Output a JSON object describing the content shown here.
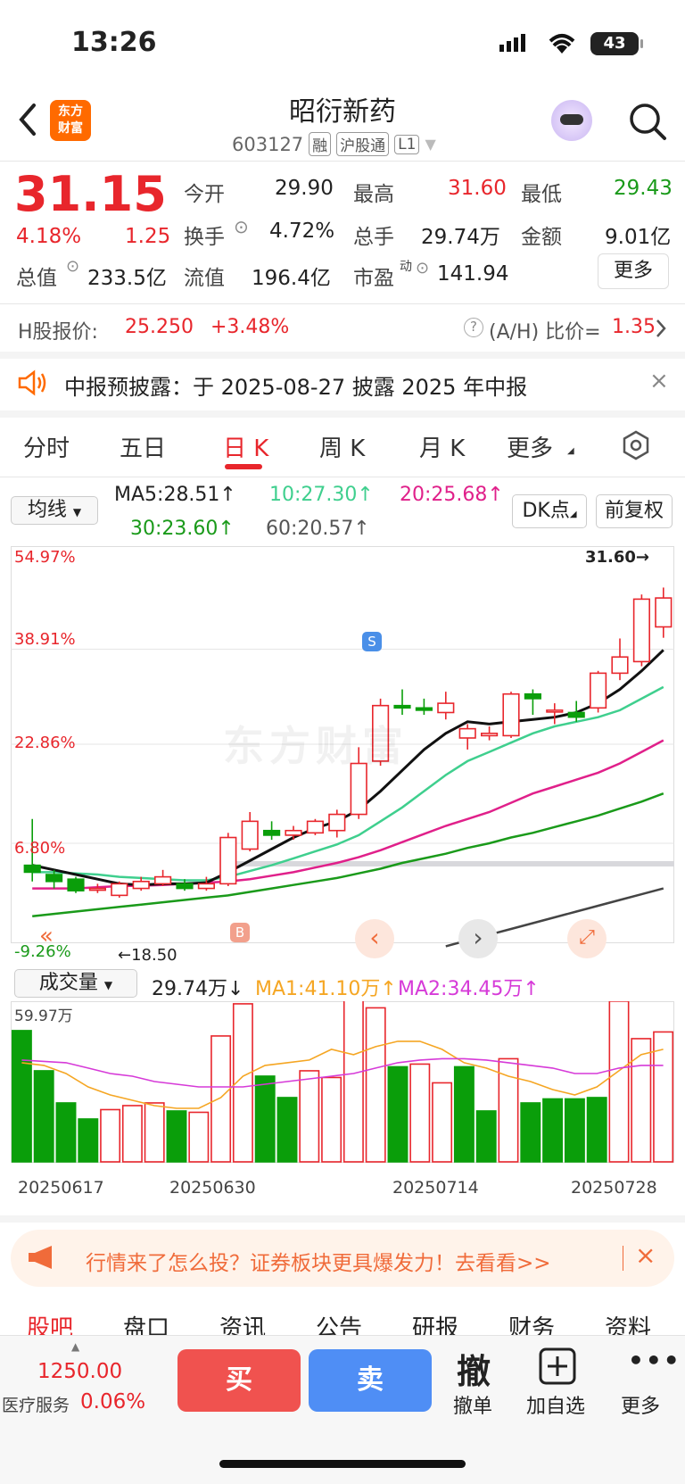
{
  "status": {
    "time": "13:26",
    "battery": "43"
  },
  "header": {
    "name": "昭衍新药",
    "code": "603127",
    "tags": [
      "融",
      "沪股通",
      "L1"
    ]
  },
  "quote": {
    "price": "31.15",
    "change_pct": "4.18%",
    "change": "1.25",
    "open_label": "今开",
    "open": "29.90",
    "high_label": "最高",
    "high": "31.60",
    "low_label": "最低",
    "low": "29.43",
    "turnover_label": "换手",
    "turnover": "4.72%",
    "volume_label": "总手",
    "volume": "29.74万",
    "amount_label": "金额",
    "amount": "9.01亿",
    "mktcap_label": "总值",
    "mktcap": "233.5亿",
    "float_label": "流值",
    "float": "196.4亿",
    "pe_label": "市盈",
    "pe_sup": "动",
    "pe": "141.94",
    "more": "更多"
  },
  "hshare": {
    "label": "H股报价:",
    "price": "25.250",
    "pct": "+3.48%",
    "ah_label": "(A/H) 比价=",
    "ah": "1.35"
  },
  "notice": {
    "text": "中报预披露：于 2025-08-27 披露 2025 年中报"
  },
  "tabs": [
    "分时",
    "五日",
    "日 K",
    "周 K",
    "月 K",
    "更多"
  ],
  "ma_bar": {
    "selector": "均线",
    "ma5": "MA5:28.51↑",
    "ma10": "10:27.30↑",
    "ma20": "20:25.68↑",
    "ma30": "30:23.60↑",
    "ma60": "60:20.57↑",
    "dk": "DK点",
    "fq": "前复权"
  },
  "kchart": {
    "y_labels": [
      "54.97%",
      "38.91%",
      "22.86%",
      "6.80%",
      "-9.26%"
    ],
    "max_label": "31.60→",
    "min_label": "←18.50",
    "watermark": "东方财富",
    "s_marker": "S",
    "b_marker": "B"
  },
  "vol_bar": {
    "selector": "成交量",
    "vol": "29.74万↓",
    "ma1": "MA1:41.10万↑",
    "ma2": "MA2:34.45万↑",
    "top_label": "59.97万"
  },
  "x_dates": [
    "20250617",
    "20250630",
    "20250714",
    "20250728"
  ],
  "chart_data": {
    "type": "candlestick",
    "price_range": [
      16.27,
      33.39
    ],
    "candles": [
      {
        "o": 19.6,
        "c": 19.3,
        "h": 21.6,
        "l": 18.9
      },
      {
        "o": 19.2,
        "c": 18.9,
        "h": 19.4,
        "l": 18.6
      },
      {
        "o": 19.0,
        "c": 18.5,
        "h": 19.1,
        "l": 18.4
      },
      {
        "o": 18.6,
        "c": 18.6,
        "h": 18.8,
        "l": 18.4
      },
      {
        "o": 18.3,
        "c": 18.8,
        "h": 18.9,
        "l": 18.2
      },
      {
        "o": 18.6,
        "c": 18.9,
        "h": 19.1,
        "l": 18.5
      },
      {
        "o": 18.8,
        "c": 19.1,
        "h": 19.4,
        "l": 18.7
      },
      {
        "o": 18.8,
        "c": 18.6,
        "h": 19.0,
        "l": 18.5
      },
      {
        "o": 18.6,
        "c": 18.8,
        "h": 19.1,
        "l": 18.5
      },
      {
        "o": 18.8,
        "c": 20.8,
        "h": 21.0,
        "l": 18.7
      },
      {
        "o": 20.3,
        "c": 21.5,
        "h": 21.9,
        "l": 20.2
      },
      {
        "o": 21.1,
        "c": 20.9,
        "h": 21.5,
        "l": 20.7
      },
      {
        "o": 20.9,
        "c": 21.1,
        "h": 21.3,
        "l": 20.7
      },
      {
        "o": 21.0,
        "c": 21.5,
        "h": 21.6,
        "l": 20.9
      },
      {
        "o": 21.1,
        "c": 21.8,
        "h": 22.0,
        "l": 20.8
      },
      {
        "o": 21.8,
        "c": 24.0,
        "h": 24.7,
        "l": 21.6
      },
      {
        "o": 24.1,
        "c": 26.5,
        "h": 26.8,
        "l": 23.9
      },
      {
        "o": 26.5,
        "c": 26.4,
        "h": 27.2,
        "l": 26.1
      },
      {
        "o": 26.4,
        "c": 26.3,
        "h": 26.8,
        "l": 26.1
      },
      {
        "o": 26.2,
        "c": 26.6,
        "h": 27.1,
        "l": 25.9
      },
      {
        "o": 25.1,
        "c": 25.5,
        "h": 25.7,
        "l": 24.6
      },
      {
        "o": 25.2,
        "c": 25.3,
        "h": 25.6,
        "l": 25.0
      },
      {
        "o": 25.2,
        "c": 27.0,
        "h": 27.1,
        "l": 25.1
      },
      {
        "o": 27.0,
        "c": 26.8,
        "h": 27.2,
        "l": 26.1
      },
      {
        "o": 26.3,
        "c": 26.3,
        "h": 26.6,
        "l": 25.7
      },
      {
        "o": 26.2,
        "c": 26.0,
        "h": 26.7,
        "l": 25.8
      },
      {
        "o": 26.4,
        "c": 27.9,
        "h": 28.0,
        "l": 26.2
      },
      {
        "o": 27.9,
        "c": 28.6,
        "h": 29.4,
        "l": 27.6
      },
      {
        "o": 28.4,
        "c": 31.1,
        "h": 31.3,
        "l": 28.2
      },
      {
        "o": 29.9,
        "c": 31.15,
        "h": 31.6,
        "l": 29.43
      }
    ],
    "ma5": [
      19.6,
      19.4,
      19.2,
      19.0,
      18.8,
      18.75,
      18.8,
      18.8,
      18.85,
      19.3,
      19.8,
      20.3,
      20.8,
      21.2,
      21.5,
      22.0,
      22.8,
      23.7,
      24.6,
      25.3,
      25.8,
      25.7,
      25.8,
      25.9,
      26.0,
      26.2,
      26.6,
      27.2,
      28.0,
      28.9
    ],
    "ma10": [
      19.3,
      19.3,
      19.25,
      19.2,
      19.1,
      19.05,
      19.0,
      18.95,
      18.95,
      19.1,
      19.35,
      19.6,
      19.9,
      20.2,
      20.5,
      20.9,
      21.5,
      22.1,
      22.8,
      23.5,
      24.1,
      24.5,
      24.9,
      25.3,
      25.6,
      25.8,
      26.0,
      26.3,
      26.8,
      27.3
    ],
    "ma20": [
      18.6,
      18.6,
      18.6,
      18.65,
      18.7,
      18.72,
      18.75,
      18.8,
      18.85,
      18.9,
      19.0,
      19.15,
      19.3,
      19.5,
      19.7,
      19.95,
      20.25,
      20.6,
      20.95,
      21.3,
      21.6,
      21.9,
      22.3,
      22.7,
      23.0,
      23.3,
      23.6,
      24.0,
      24.5,
      25.0
    ],
    "ma30": [
      17.4,
      17.5,
      17.6,
      17.7,
      17.8,
      17.9,
      18.0,
      18.1,
      18.2,
      18.3,
      18.45,
      18.6,
      18.75,
      18.9,
      19.05,
      19.25,
      19.45,
      19.7,
      19.9,
      20.1,
      20.35,
      20.55,
      20.8,
      21.0,
      21.25,
      21.5,
      21.75,
      22.05,
      22.35,
      22.7
    ],
    "ma60": [
      null,
      null,
      null,
      null,
      null,
      null,
      null,
      null,
      null,
      null,
      null,
      null,
      null,
      null,
      null,
      null,
      null,
      null,
      null,
      16.1,
      16.35,
      16.6,
      16.85,
      17.1,
      17.35,
      17.6,
      17.85,
      18.1,
      18.35,
      18.6
    ],
    "volume_range": [
      0,
      59.97
    ],
    "volumes": [
      49,
      34,
      22,
      16,
      19.5,
      21,
      22,
      19,
      18.5,
      47,
      59,
      32,
      24,
      34,
      31.5,
      61,
      57.5,
      35.5,
      36.5,
      29.5,
      35.5,
      19,
      38.5,
      22,
      23.5,
      23.5,
      24,
      60,
      46,
      48.5
    ],
    "vol_up": [
      false,
      false,
      false,
      false,
      true,
      true,
      true,
      false,
      true,
      true,
      true,
      false,
      false,
      true,
      true,
      true,
      true,
      false,
      true,
      true,
      false,
      false,
      true,
      false,
      false,
      false,
      false,
      true,
      true,
      true
    ],
    "vol_ma1": [
      37,
      36,
      33,
      28,
      25,
      23,
      21,
      20,
      20,
      24,
      32,
      36,
      37,
      38,
      42,
      40,
      43,
      45,
      45,
      42,
      37,
      35,
      32,
      30,
      27,
      25,
      28,
      34,
      40,
      42
    ],
    "vol_ma2": [
      38,
      37.5,
      37,
      35,
      33,
      32,
      30,
      29,
      28,
      28,
      28,
      29,
      30,
      31,
      32,
      33,
      35,
      37,
      38,
      38.5,
      38.5,
      38,
      37,
      36,
      35,
      33,
      33,
      35,
      36,
      36
    ]
  },
  "ad": {
    "text": "行情来了怎么投？证券板块更具爆发力！去看看>>"
  },
  "bottom_tabs": [
    "股吧",
    "盘口",
    "资讯",
    "公告",
    "研报",
    "财务",
    "资料"
  ],
  "bottom": {
    "index_value": "1250.00",
    "index_name": "医疗服务",
    "index_pct": "0.06%",
    "buy": "买",
    "sell": "卖",
    "revoke_icon": "撤",
    "revoke": "撤单",
    "add": "加自选",
    "more": "更多"
  }
}
